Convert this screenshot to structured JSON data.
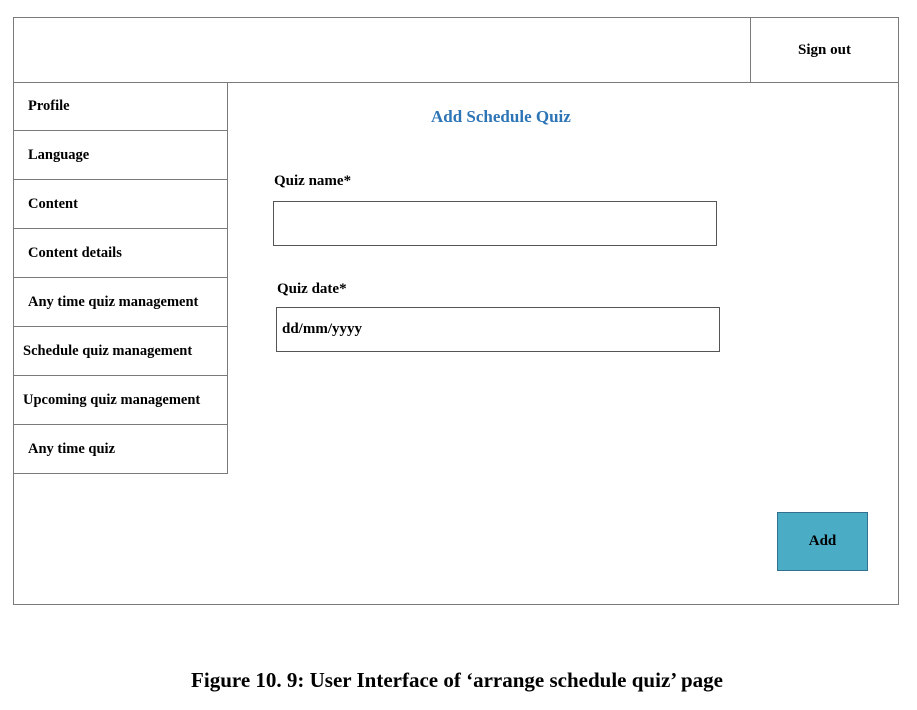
{
  "header": {
    "sign_out_label": "Sign out"
  },
  "sidebar": {
    "items": [
      {
        "label": "Profile"
      },
      {
        "label": "Language"
      },
      {
        "label": "Content"
      },
      {
        "label": "Content details"
      },
      {
        "label": "Any time quiz management"
      },
      {
        "label": "Schedule quiz management"
      },
      {
        "label": "Upcoming quiz management"
      },
      {
        "label": "Any time quiz"
      }
    ]
  },
  "main": {
    "title": "Add Schedule Quiz",
    "quiz_name": {
      "label": "Quiz name*",
      "value": ""
    },
    "quiz_date": {
      "label": "Quiz date*",
      "placeholder": "dd/mm/yyyy"
    },
    "add_button_label": "Add"
  },
  "caption": "Figure 10. 9: User Interface of ‘arrange schedule quiz’ page",
  "colors": {
    "title": "#2e75b6",
    "add_button": "#4bacc6"
  }
}
